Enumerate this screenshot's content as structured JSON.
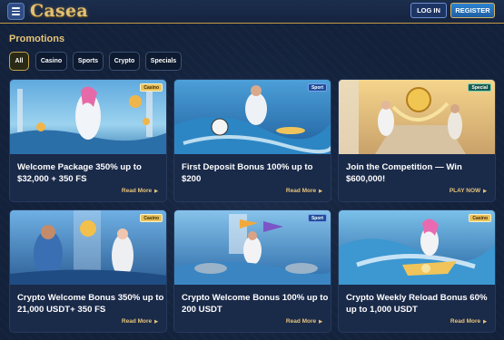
{
  "header": {
    "logo": "Casea",
    "login_label": "LOG IN",
    "register_label": "REGISTER"
  },
  "page": {
    "title": "Promotions"
  },
  "filters": [
    {
      "label": "All",
      "active": true
    },
    {
      "label": "Casino",
      "active": false
    },
    {
      "label": "Sports",
      "active": false
    },
    {
      "label": "Crypto",
      "active": false
    },
    {
      "label": "Specials",
      "active": false
    }
  ],
  "promotions": [
    {
      "badge": "Casino",
      "badge_type": "casino",
      "title": "Welcome Package 350% up to $32,000 + 350 FS",
      "cta": "Read More"
    },
    {
      "badge": "Sport",
      "badge_type": "sport",
      "title": "First Deposit Bonus 100% up to $200",
      "cta": "Read More"
    },
    {
      "badge": "Special",
      "badge_type": "special",
      "title": "Join the Competition — Win $600,000!",
      "cta": "PLAY NOW"
    },
    {
      "badge": "Casino",
      "badge_type": "casino",
      "title": "Crypto Welcome Bonus 350% up to 21,000 USDT+ 350 FS",
      "cta": "Read More"
    },
    {
      "badge": "Sport",
      "badge_type": "sport",
      "title": "Crypto Welcome Bonus 100% up to 200 USDT",
      "cta": "Read More"
    },
    {
      "badge": "Casino",
      "badge_type": "casino",
      "title": "Crypto Weekly Reload Bonus 60% up to 1,000 USDT",
      "cta": "Read More"
    }
  ],
  "colors": {
    "gold": "#e6c47a",
    "background": "#13213a",
    "card": "#1a2a49"
  }
}
